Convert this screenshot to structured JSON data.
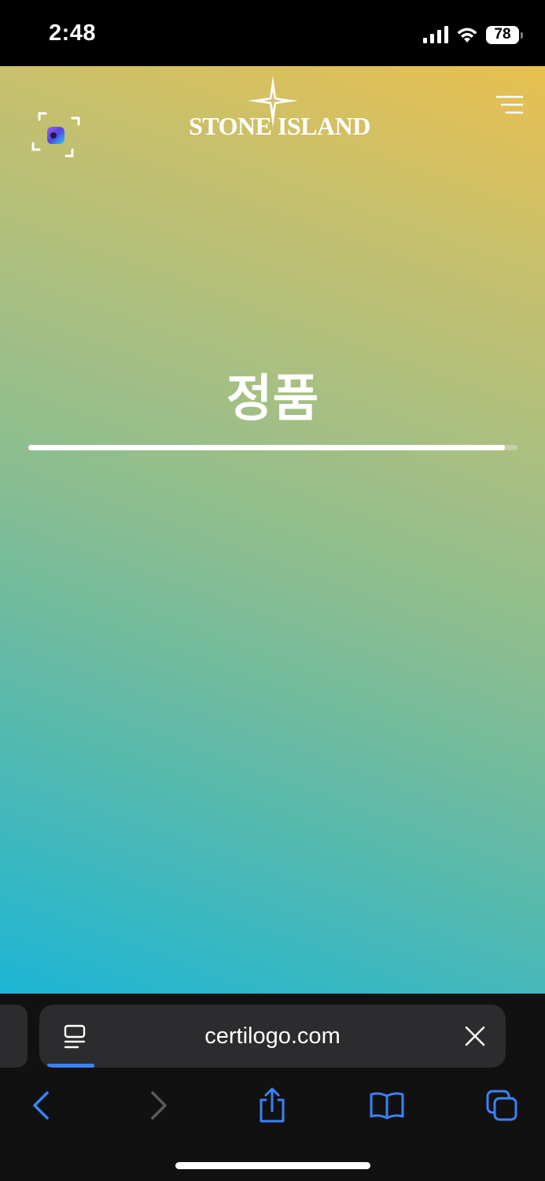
{
  "status_bar": {
    "time": "2:48",
    "battery_level": "78",
    "icons": [
      "cellular-signal-icon",
      "wifi-icon",
      "battery-icon"
    ]
  },
  "page": {
    "brand": "STONE ISLAND",
    "auth_result": "정품",
    "progress": 0.975,
    "icons": [
      "scan-frame-icon",
      "star-compass-icon",
      "menu-icon"
    ],
    "gradient_colors": [
      "#e9c04f",
      "#86bd92",
      "#1db6d6"
    ]
  },
  "browser": {
    "url": "certilogo.com",
    "accent_color": "#3b82f6",
    "toolbar": [
      "back-icon",
      "forward-icon",
      "share-icon",
      "bookmarks-icon",
      "tabs-icon"
    ]
  }
}
